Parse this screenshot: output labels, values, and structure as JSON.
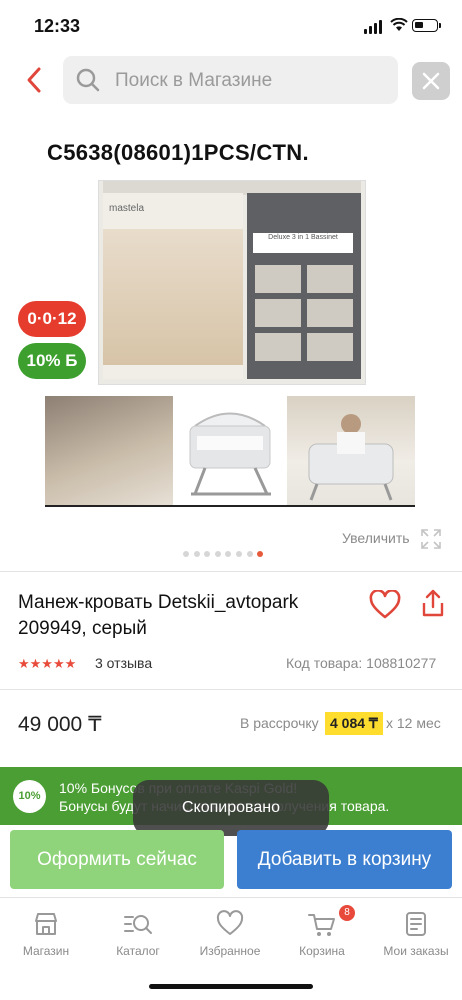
{
  "status": {
    "time": "12:33"
  },
  "search": {
    "placeholder": "Поиск в Магазине"
  },
  "gallery": {
    "image_title": "C5638(08601)1PCS/CTN.",
    "box_brand": "mastela",
    "box_side_heading": "Deluxe 3 in 1 Bassinet",
    "badge_age": "0·0·12",
    "badge_bonus": "10% Б",
    "dots_total": 8,
    "dots_active_index": 7,
    "zoom_label": "Увеличить"
  },
  "product": {
    "title": "Манеж-кровать Detskii_avtopark 209949, серый",
    "rating_stars": "★★★★★",
    "reviews": "3 отзыва",
    "code": "Код товара: 108810277",
    "price": "49 000 ₸",
    "installment_prefix": "В рассрочку",
    "installment_amount": "4 084 ₸",
    "installment_term": "x 12 мес"
  },
  "bonus_banner": {
    "percent": "10%",
    "line1": "10% Бонусов при оплате Kaspi Gold!",
    "line2": "Бонусы будут начислены после получения товара."
  },
  "toast": {
    "text": "Скопировано"
  },
  "actions": {
    "order_now": "Оформить сейчас",
    "add_to_cart": "Добавить в корзину"
  },
  "tabbar": {
    "items": [
      {
        "label": "Магазин",
        "icon": "store-icon"
      },
      {
        "label": "Каталог",
        "icon": "catalog-icon"
      },
      {
        "label": "Избранное",
        "icon": "heart-icon"
      },
      {
        "label": "Корзина",
        "icon": "cart-icon"
      },
      {
        "label": "Мои заказы",
        "icon": "orders-icon"
      }
    ],
    "cart_count": "8"
  },
  "colors": {
    "accent_red": "#e63c2e",
    "bonus_green": "#4a9e33",
    "cart_blue": "#3c7fd0",
    "order_green": "#8fd47a",
    "installment_yellow": "#ffdd2e"
  }
}
